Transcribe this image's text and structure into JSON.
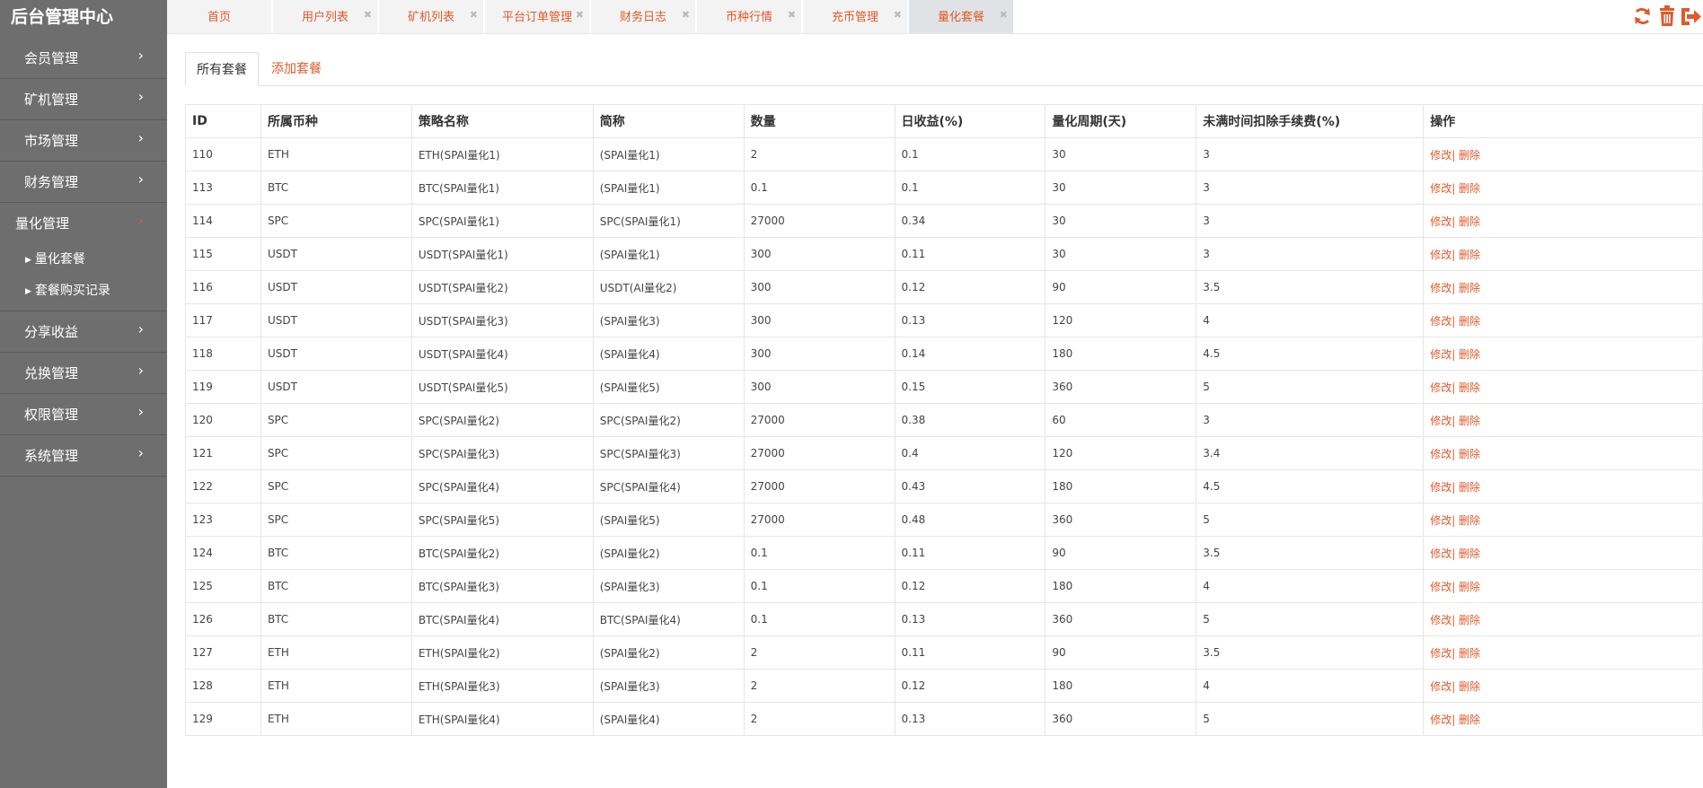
{
  "app": {
    "title": "后台管理中心"
  },
  "sidebar": {
    "items": [
      {
        "label": "会员管理"
      },
      {
        "label": "矿机管理"
      },
      {
        "label": "市场管理"
      },
      {
        "label": "财务管理"
      }
    ],
    "active": {
      "label": "量化管理",
      "children": [
        "量化套餐",
        "套餐购买记录"
      ]
    },
    "items_after": [
      {
        "label": "分享收益"
      },
      {
        "label": "兑换管理"
      },
      {
        "label": "权限管理"
      },
      {
        "label": "系统管理"
      }
    ]
  },
  "tabs": [
    "首页",
    "用户列表",
    "矿机列表",
    "平台订单管理",
    "财务日志",
    "币种行情",
    "充币管理",
    "量化套餐"
  ],
  "tools": {
    "refresh_icon": "refresh-icon",
    "trash_icon": "trash-icon",
    "logout_icon": "logout-icon",
    "accent": "#e05a2b"
  },
  "subtabs": {
    "all": "所有套餐",
    "add": "添加套餐"
  },
  "table": {
    "headers": [
      "ID",
      "所属币种",
      "策略名称",
      "简称",
      "数量",
      "日收益(%)",
      "量化周期(天)",
      "未满时间扣除手续费(%)",
      "操作"
    ],
    "edit_label": "修改|",
    "delete_label": " 删除",
    "rows": [
      [
        "110",
        "ETH",
        "ETH(SPAI量化1)",
        "(SPAI量化1)",
        "2",
        "0.1",
        "30",
        "3"
      ],
      [
        "113",
        "BTC",
        "BTC(SPAI量化1)",
        "(SPAI量化1)",
        "0.1",
        "0.1",
        "30",
        "3"
      ],
      [
        "114",
        "SPC",
        "SPC(SPAI量化1)",
        "SPC(SPAI量化1)",
        "27000",
        "0.34",
        "30",
        "3"
      ],
      [
        "115",
        "USDT",
        "USDT(SPAI量化1)",
        "(SPAI量化1)",
        "300",
        "0.11",
        "30",
        "3"
      ],
      [
        "116",
        "USDT",
        "USDT(SPAI量化2)",
        "USDT(AI量化2)",
        "300",
        "0.12",
        "90",
        "3.5"
      ],
      [
        "117",
        "USDT",
        "USDT(SPAI量化3)",
        "(SPAI量化3)",
        "300",
        "0.13",
        "120",
        "4"
      ],
      [
        "118",
        "USDT",
        "USDT(SPAI量化4)",
        "(SPAI量化4)",
        "300",
        "0.14",
        "180",
        "4.5"
      ],
      [
        "119",
        "USDT",
        "USDT(SPAI量化5)",
        "(SPAI量化5)",
        "300",
        "0.15",
        "360",
        "5"
      ],
      [
        "120",
        "SPC",
        "SPC(SPAI量化2)",
        "SPC(SPAI量化2)",
        "27000",
        "0.38",
        "60",
        "3"
      ],
      [
        "121",
        "SPC",
        "SPC(SPAI量化3)",
        "SPC(SPAI量化3)",
        "27000",
        "0.4",
        "120",
        "3.4"
      ],
      [
        "122",
        "SPC",
        "SPC(SPAI量化4)",
        "SPC(SPAI量化4)",
        "27000",
        "0.43",
        "180",
        "4.5"
      ],
      [
        "123",
        "SPC",
        "SPC(SPAI量化5)",
        "(SPAI量化5)",
        "27000",
        "0.48",
        "360",
        "5"
      ],
      [
        "124",
        "BTC",
        "BTC(SPAI量化2)",
        "(SPAI量化2)",
        "0.1",
        "0.11",
        "90",
        "3.5"
      ],
      [
        "125",
        "BTC",
        "BTC(SPAI量化3)",
        "(SPAI量化3)",
        "0.1",
        "0.12",
        "180",
        "4"
      ],
      [
        "126",
        "BTC",
        "BTC(SPAI量化4)",
        "BTC(SPAI量化4)",
        "0.1",
        "0.13",
        "360",
        "5"
      ],
      [
        "127",
        "ETH",
        "ETH(SPAI量化2)",
        "(SPAI量化2)",
        "2",
        "0.11",
        "90",
        "3.5"
      ],
      [
        "128",
        "ETH",
        "ETH(SPAI量化3)",
        "(SPAI量化3)",
        "2",
        "0.12",
        "180",
        "4"
      ],
      [
        "129",
        "ETH",
        "ETH(SPAI量化4)",
        "(SPAI量化4)",
        "2",
        "0.13",
        "360",
        "5"
      ]
    ]
  }
}
